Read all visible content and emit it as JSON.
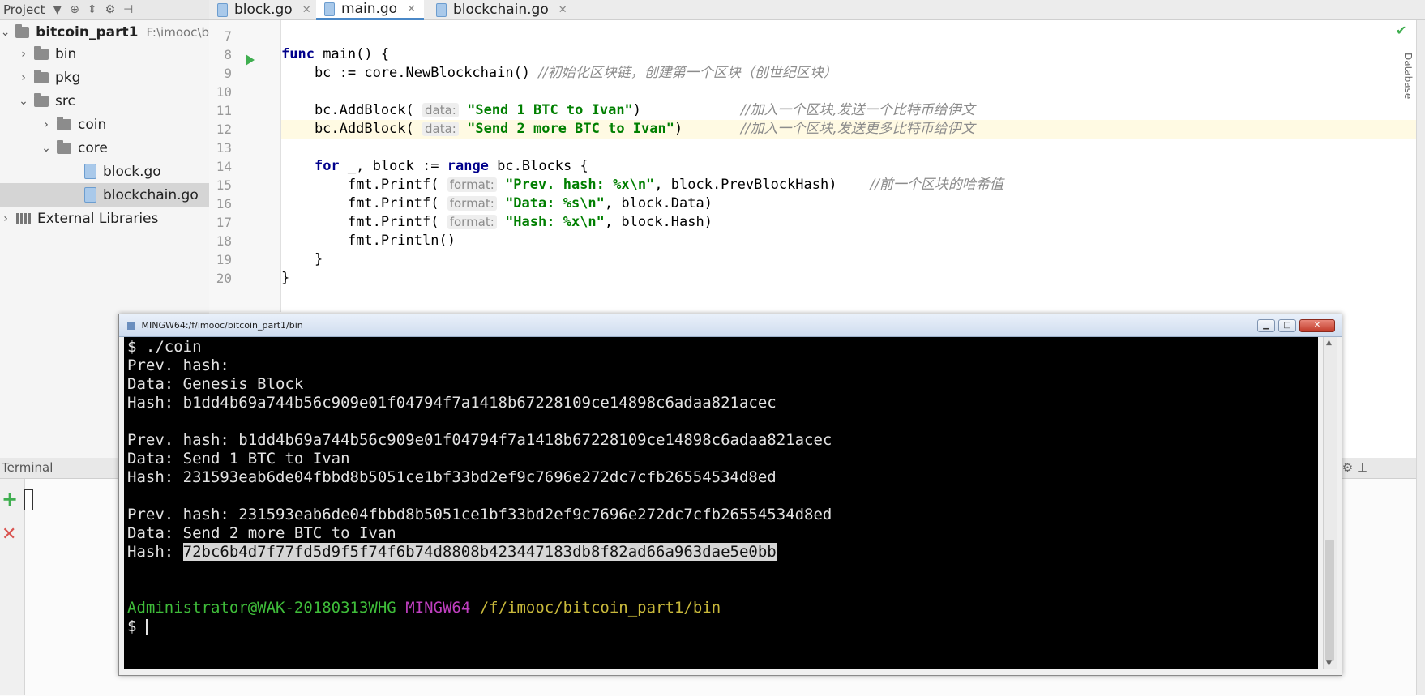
{
  "project_toolbar": {
    "title": "Project"
  },
  "sidebar": {
    "root": {
      "name": "bitcoin_part1",
      "path": "F:\\imooc\\b"
    },
    "items": [
      {
        "label": "bin"
      },
      {
        "label": "pkg"
      },
      {
        "label": "src"
      },
      {
        "label": "coin"
      },
      {
        "label": "core"
      },
      {
        "label": "block.go"
      },
      {
        "label": "blockchain.go"
      },
      {
        "label": "External Libraries"
      }
    ]
  },
  "tabs": [
    {
      "label": "block.go",
      "active": false
    },
    {
      "label": "main.go",
      "active": true
    },
    {
      "label": "blockchain.go",
      "active": false
    }
  ],
  "editor": {
    "line_numbers": [
      "7",
      "8",
      "9",
      "10",
      "11",
      "12",
      "13",
      "14",
      "15",
      "16",
      "17",
      "18",
      "19",
      "20"
    ],
    "lines": [
      {
        "t": []
      },
      {
        "t": [
          [
            "kw",
            "func"
          ],
          [
            "p",
            " main() {"
          ]
        ]
      },
      {
        "t": [
          [
            "p",
            "    bc := core.NewBlockchain() "
          ],
          [
            "cmt",
            "//初始化区块链，创建第一个区块（创世纪区块）"
          ]
        ]
      },
      {
        "t": []
      },
      {
        "t": [
          [
            "p",
            "    bc.AddBlock( "
          ],
          [
            "hint",
            "data:"
          ],
          [
            "p",
            " "
          ],
          [
            "str",
            "\"Send 1 BTC to Ivan\""
          ],
          [
            "p",
            ")            "
          ],
          [
            "cmt",
            "//加入一个区块,发送一个比特币给伊文"
          ]
        ]
      },
      {
        "t": [
          [
            "p",
            "    bc.AddBlock( "
          ],
          [
            "hint",
            "data:"
          ],
          [
            "p",
            " "
          ],
          [
            "str",
            "\"Send 2 more BTC to Ivan\""
          ],
          [
            "p",
            ")       "
          ],
          [
            "cmt",
            "//加入一个区块,发送更多比特币给伊文"
          ]
        ],
        "hl": true
      },
      {
        "t": []
      },
      {
        "t": [
          [
            "p",
            "    "
          ],
          [
            "kw",
            "for"
          ],
          [
            "p",
            " _, block := "
          ],
          [
            "kw",
            "range"
          ],
          [
            "p",
            " bc.Blocks {"
          ]
        ]
      },
      {
        "t": [
          [
            "p",
            "        fmt.Printf( "
          ],
          [
            "hint",
            "format:"
          ],
          [
            "p",
            " "
          ],
          [
            "str",
            "\"Prev. hash: %x\\n\""
          ],
          [
            "p",
            ", block.PrevBlockHash)    "
          ],
          [
            "cmt",
            "//前一个区块的哈希值"
          ]
        ]
      },
      {
        "t": [
          [
            "p",
            "        fmt.Printf( "
          ],
          [
            "hint",
            "format:"
          ],
          [
            "p",
            " "
          ],
          [
            "str",
            "\"Data: %s\\n\""
          ],
          [
            "p",
            ", block.Data)"
          ]
        ]
      },
      {
        "t": [
          [
            "p",
            "        fmt.Printf( "
          ],
          [
            "hint",
            "format:"
          ],
          [
            "p",
            " "
          ],
          [
            "str",
            "\"Hash: %x\\n\""
          ],
          [
            "p",
            ", block.Hash)"
          ]
        ]
      },
      {
        "t": [
          [
            "p",
            "        fmt.Println()"
          ]
        ]
      },
      {
        "t": [
          [
            "p",
            "    }"
          ]
        ]
      },
      {
        "t": [
          [
            "p",
            "}"
          ]
        ]
      }
    ]
  },
  "right_strip_label": "Database",
  "terminal_panel": {
    "title": "Terminal",
    "tools": "⚙ ⊥"
  },
  "mingw": {
    "title": "MINGW64:/f/imooc/bitcoin_part1/bin",
    "lines": [
      "$ ./coin",
      "Prev. hash:",
      "Data: Genesis Block",
      "Hash: b1dd4b69a744b56c909e01f04794f7a1418b67228109ce14898c6adaa821acec",
      "",
      "Prev. hash: b1dd4b69a744b56c909e01f04794f7a1418b67228109ce14898c6adaa821acec",
      "Data: Send 1 BTC to Ivan",
      "Hash: 231593eab6de04fbbd8b5051ce1bf33bd2ef9c7696e272dc7cfb26554534d8ed",
      "",
      "Prev. hash: 231593eab6de04fbbd8b5051ce1bf33bd2ef9c7696e272dc7cfb26554534d8ed",
      "Data: Send 2 more BTC to Ivan"
    ],
    "last_hash_label": "Hash: ",
    "last_hash_selected": "72bc6b4d7f77fd5d9f5f74f6b74d8808b423447183db8f82ad66a963dae5e0bb",
    "prompt": {
      "user": "Administrator@WAK-20180313WHG",
      "env": "MINGW64",
      "path": "/f/imooc/bitcoin_part1/bin",
      "symbol": "$"
    }
  }
}
